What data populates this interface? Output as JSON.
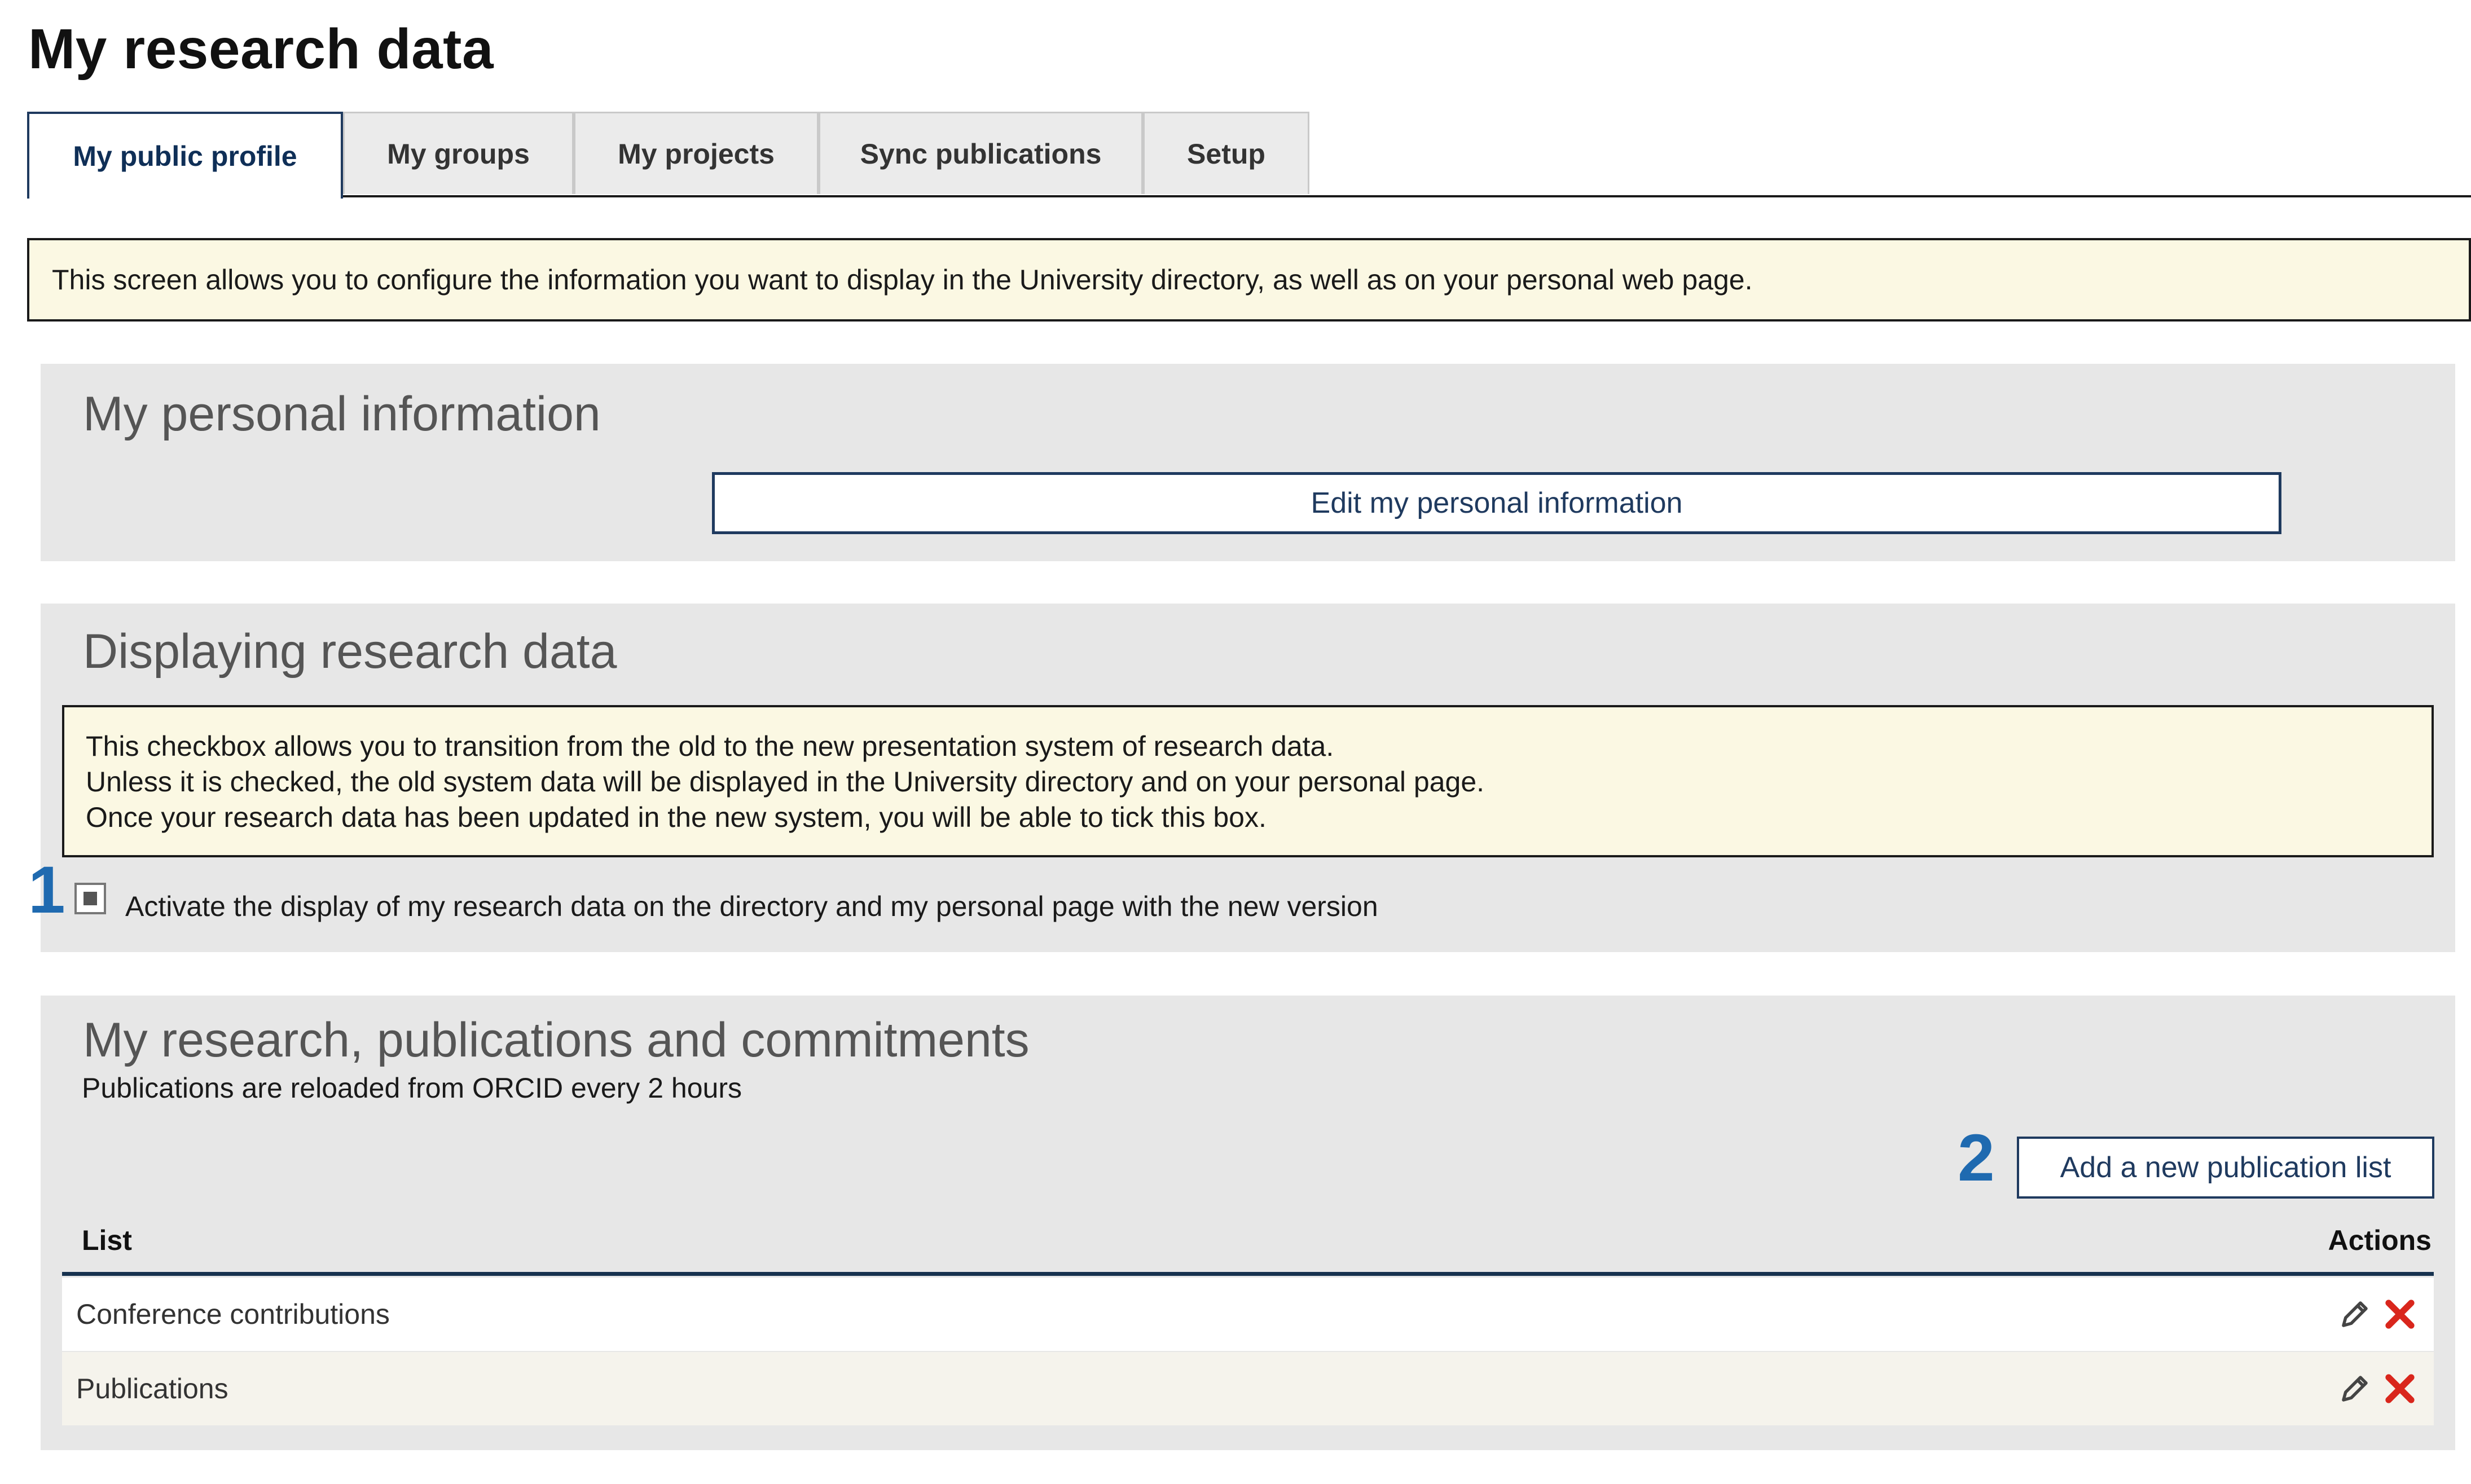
{
  "page": {
    "title": "My research data"
  },
  "tabs": [
    {
      "label": "My public profile",
      "active": true
    },
    {
      "label": "My groups",
      "active": false
    },
    {
      "label": "My projects",
      "active": false
    },
    {
      "label": "Sync publications",
      "active": false
    },
    {
      "label": "Setup",
      "active": false
    }
  ],
  "notice_top": "This screen allows you to configure the information you want to display in the University directory, as well as on your personal web page.",
  "personal_info": {
    "title": "My personal information",
    "edit_button": "Edit my personal information"
  },
  "research_display": {
    "title": "Displaying research data",
    "notice_lines": [
      "This checkbox allows you to transition from the old to the new presentation system of research data.",
      "Unless it is checked, the old system data will be displayed in the University directory and on your personal page.",
      "Once your research data has been updated in the new system, you will be able to tick this box."
    ],
    "marker": "1",
    "checkbox_label": "Activate the display of my research data on the directory and my personal page with the new version"
  },
  "publications": {
    "title": "My research, publications and commitments",
    "subtitle": "Publications are reloaded from ORCID every 2 hours",
    "marker": "2",
    "add_button": "Add a new publication list",
    "columns": {
      "list": "List",
      "actions": "Actions"
    },
    "rows": [
      {
        "name": "Conference contributions"
      },
      {
        "name": "Publications"
      }
    ]
  },
  "colors": {
    "accent": "#1f3a5f",
    "marker": "#1f6ab0",
    "notice_bg": "#fbf8e3",
    "panel_bg": "#e7e7e7",
    "delete": "#d9261c"
  },
  "icons": [
    "pencil-icon",
    "delete-x-icon"
  ]
}
